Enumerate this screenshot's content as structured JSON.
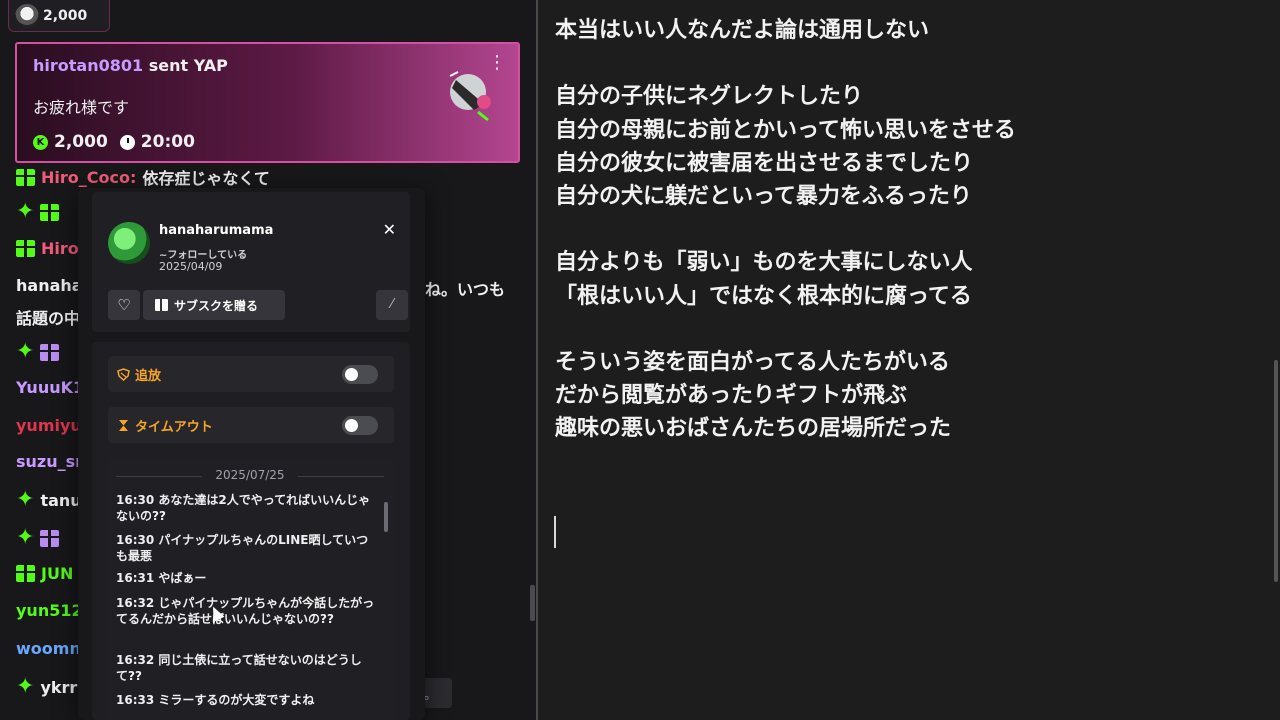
{
  "top_badge": {
    "amount": "2,000"
  },
  "gift_card": {
    "sender": "hirotan0801",
    "action": "sent YAP",
    "message": "お疲れ様です",
    "coin_symbol": "K",
    "amount": "2,000",
    "duration": "20:00",
    "accent_color": "#d54fa3"
  },
  "chat": {
    "lines": [
      {
        "user": "Hiro_Coco",
        "color": "#f25c7a",
        "text": "依存症じゃなくて",
        "icon": "gift-icon"
      },
      {
        "user": "",
        "color": "#f25c7a",
        "text": "",
        "icon": "sparkle-gift-icon"
      },
      {
        "user": "Hiro",
        "color": "#f25c7a",
        "text": "",
        "icon": "gift-icon"
      },
      {
        "user": "hanaha",
        "color": "#efeff1",
        "text": "",
        "icon": ""
      },
      {
        "user": "",
        "color": "#c79bff",
        "text": "",
        "icon": "sparkle-gift-icon"
      },
      {
        "user": "YuuuK1",
        "color": "#c79bff",
        "text": "",
        "icon": ""
      },
      {
        "user": "yumiyu",
        "color": "#e0344f",
        "text": "",
        "icon": ""
      },
      {
        "user": "suzu_sı",
        "color": "#c79bff",
        "text": "",
        "icon": ""
      },
      {
        "user": "tanu",
        "color": "#efeff1",
        "text": "",
        "icon": "sparkle-icon"
      },
      {
        "user": "",
        "color": "#efeff1",
        "text": "",
        "icon": "sparkle-gift-icon"
      },
      {
        "user": "JUN",
        "color": "#53fc18",
        "text": "",
        "icon": "gift-icon"
      },
      {
        "user": "yun512",
        "color": "#53fc18",
        "text": "",
        "icon": ""
      },
      {
        "user": "woomn",
        "color": "#6aa8ff",
        "text": "",
        "icon": ""
      },
      {
        "user": "ykrr",
        "color": "#efeff1",
        "text": "",
        "icon": "sparkle-icon"
      }
    ],
    "tail_1": "ね。いつも",
    "tail_2": "話題の中",
    "input_fragment": "。"
  },
  "user_card": {
    "username": "hanaharumama",
    "follow_status": "~フォローしている",
    "follow_date": "2025/04/09",
    "close_label": "✕",
    "heart_label": "♡",
    "sub_gift_label": "サブスクを贈る",
    "mute_label": "⁄",
    "ban_label": "追放",
    "timeout_label": "タイムアウト",
    "log_date": "2025/07/25",
    "log": [
      "16:30 あなた達は2人でやってればいいんじゃないの??",
      "16:30 パイナップルちゃんのLINE晒していつも最悪",
      "16:31 やばぁー",
      "16:32 じゃパイナップルちゃんが今話したがってるんだから話せばいいんじゃないの??",
      "16:32 同じ土俵に立って話せないのはどうして??",
      "16:33 ミラーするのが大変ですよね"
    ]
  },
  "notepad": {
    "text": "本当はいい人なんだよ論は通用しない\n\n自分の子供にネグレクトしたり\n自分の母親にお前とかいって怖い思いをさせる\n自分の彼女に被害届を出させるまでしたり\n自分の犬に躾だといって暴力をふるったり\n\n自分よりも「弱い」ものを大事にしない人\n「根はいい人」ではなく根本的に腐ってる\n\nそういう姿を面白がってる人たちがいる\nだから閲覧があったりギフトが飛ぶ\n趣味の悪いおばさんたちの居場所だった"
  }
}
